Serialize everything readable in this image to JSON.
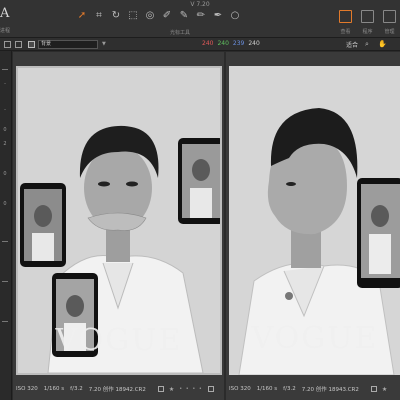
{
  "window": {
    "title": "V 7.20"
  },
  "app": {
    "mark": "A",
    "sub_label": "进程"
  },
  "toolbar": {
    "tools": [
      "select-tool",
      "crop-tool",
      "rotate-tool",
      "keystone-tool",
      "spot-tool",
      "eyedropper-tool",
      "brush-tool",
      "eraser-tool",
      "gradient-tool",
      "circle-tool"
    ],
    "caption": "光标工具",
    "right_captions": [
      "查看",
      "程序",
      "管理"
    ]
  },
  "toolbar2": {
    "background_value": "背景",
    "rgb": {
      "r": "240",
      "g": "240",
      "b": "239",
      "a": "240"
    },
    "fit_label": "适合"
  },
  "sidebar": {
    "marks": [
      "-",
      "-",
      "0",
      "2",
      "0",
      "0"
    ]
  },
  "left_pane": {
    "watermark": "VOGUE",
    "caption": {
      "iso": "ISO 320",
      "shutter": "1/160 s",
      "aperture": "f/3.2",
      "file": "7.20 创作 18942.CR2"
    }
  },
  "right_pane": {
    "watermark": "VOGUE",
    "caption": {
      "iso": "ISO 320",
      "shutter": "1/160 s",
      "aperture": "f/3.2",
      "file": "7.20 创作 18943.CR2"
    }
  },
  "colors": {
    "accent": "#e27a2b",
    "bg": "#2b2b2b",
    "panel": "#3a3a3a"
  }
}
